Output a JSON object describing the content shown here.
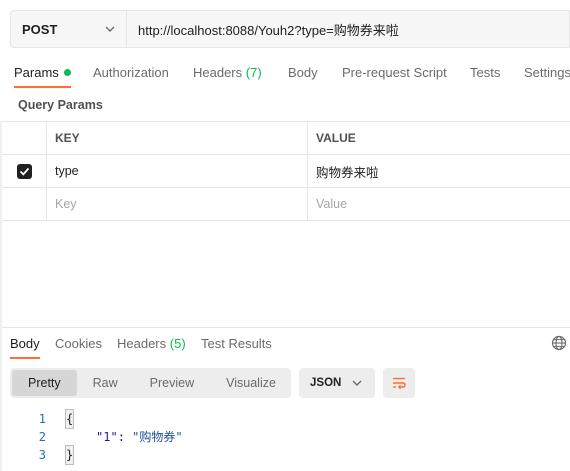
{
  "request": {
    "method": "POST",
    "url": "http://localhost:8088/Youh2?type=购物券来啦"
  },
  "request_tabs": {
    "params": "Params",
    "authorization": "Authorization",
    "headers": "Headers",
    "headers_count": "(7)",
    "body": "Body",
    "prerequest": "Pre-request Script",
    "tests": "Tests",
    "settings": "Settings"
  },
  "query_params": {
    "title": "Query Params",
    "columns": {
      "key": "KEY",
      "value": "VALUE"
    },
    "rows": [
      {
        "checked": true,
        "key": "type",
        "value": "购物券来啦"
      }
    ],
    "placeholder": {
      "key": "Key",
      "value": "Value"
    }
  },
  "response_tabs": {
    "body": "Body",
    "cookies": "Cookies",
    "headers": "Headers",
    "headers_count": "(5)",
    "test_results": "Test Results"
  },
  "response_toolbar": {
    "pretty": "Pretty",
    "raw": "Raw",
    "preview": "Preview",
    "visualize": "Visualize",
    "format": "JSON"
  },
  "response_body": {
    "lines": [
      {
        "num": "1",
        "open": "{"
      },
      {
        "num": "2",
        "key": "\"1\"",
        "sep": ": ",
        "value": "\"购物券\""
      },
      {
        "num": "3",
        "close": "}"
      }
    ]
  },
  "colors": {
    "accent": "#ff6c37",
    "status_green": "#0cbb52"
  },
  "icons": [
    "chevron-down-icon",
    "checkbox-checked-icon",
    "globe-icon",
    "wrap-lines-icon"
  ]
}
